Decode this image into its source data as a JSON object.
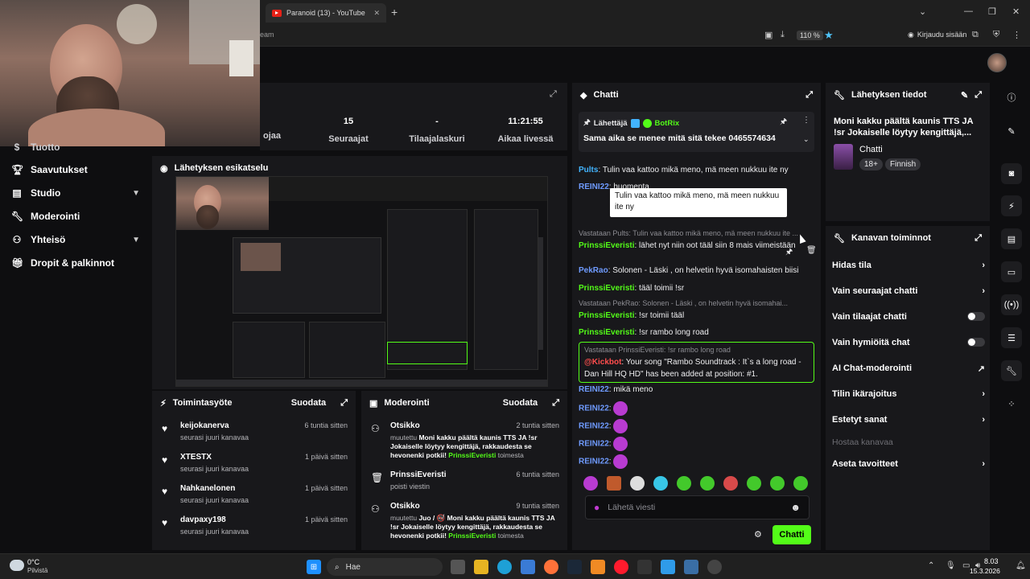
{
  "browser": {
    "tab_title": "Paranoid (13) - YouTube",
    "url_fragment": "eam",
    "zoom": "110 %",
    "login_label": "Kirjaudu sisään"
  },
  "stats": [
    {
      "value": "",
      "label": "ojaa"
    },
    {
      "value": "15",
      "label": "Seuraajat"
    },
    {
      "value": "-",
      "label": "Tilaajalaskuri"
    },
    {
      "value": "11:21:55",
      "label": "Aikaa livessä"
    }
  ],
  "nav": {
    "partial_top": "Tuotto",
    "items": [
      {
        "label": "Saavutukset",
        "icon": "trophy-icon",
        "chevron": false
      },
      {
        "label": "Studio",
        "icon": "film-icon",
        "chevron": true
      },
      {
        "label": "Moderointi",
        "icon": "wrench-icon",
        "chevron": false
      },
      {
        "label": "Yhteisö",
        "icon": "community-icon",
        "chevron": true
      },
      {
        "label": "Dropit & palkinnot",
        "icon": "gift-icon",
        "chevron": false
      }
    ]
  },
  "preview": {
    "title": "Lähetyksen esikatselu"
  },
  "activity": {
    "title": "Toimintasyöte",
    "filter": "Suodata",
    "items": [
      {
        "name": "keijokanerva",
        "sub": "seurasi juuri kanavaa",
        "time": "6 tuntia sitten"
      },
      {
        "name": "XTESTX",
        "sub": "seurasi juuri kanavaa",
        "time": "1 päivä sitten"
      },
      {
        "name": "Nahkanelonen",
        "sub": "seurasi juuri kanavaa",
        "time": "1 päivä sitten"
      },
      {
        "name": "davpaxy198",
        "sub": "seurasi juuri kanavaa",
        "time": "1 päivä sitten"
      }
    ]
  },
  "moderation": {
    "title": "Moderointi",
    "filter": "Suodata",
    "items": [
      {
        "name": "Otsikko",
        "time": "2 tuntia sitten",
        "line1": "muutettu ",
        "bold1": "Moni kakku päältä kaunis TTS JA !sr Jokaiselle löytyy kengittäjä, rakkaudesta se hevonenki potkii!",
        "by": "PrinssiEveristi",
        "tail": " toimesta"
      },
      {
        "name": "PrinssiEveristi",
        "time": "6 tuntia sitten",
        "line1": "poisti viestin"
      },
      {
        "name": "Otsikko",
        "time": "9 tuntia sitten",
        "line1": "muutettu ",
        "bold1": "Juo / 🚭 Moni kakku päältä kaunis TTS JA !sr Jokaiselle löytyy kengittäjä, rakkaudesta se hevonenki potkii!",
        "by": "PrinssiEveristi",
        "tail": " toimesta"
      }
    ]
  },
  "chat": {
    "title": "Chatti",
    "pinned": {
      "sender_label": "Lähettäjä",
      "sender": "BotRix",
      "text": "Sama aika se menee mitä sitä tekee 0465574634"
    },
    "tooltip": "Tulin vaa kattoo mikä meno, mä meen nukkuu ite ny",
    "messages": [
      {
        "user": "Pults",
        "text": " Tulin vaa kattoo mikä meno, mä meen nukkuu ite ny",
        "color": "#42b4ff"
      },
      {
        "user": "REINI22",
        "text": " huomenta",
        "color": "#6f9bff"
      },
      {
        "reply": "Vastataan Pults: Tulin vaa kattoo mikä meno, mä meen nukkuu ite ...",
        "user": "PrinssiEveristi",
        "text": " lähet nyt niin oot tääl siin 8 mais viimeistään",
        "color": "#53fc18"
      },
      {
        "user": "PekRao",
        "text": " Solonen - Läski , on helvetin hyvä isomahaisten biisi",
        "color": "#6f9bff"
      },
      {
        "user": "PrinssiEveristi",
        "text": " tääl toimii !sr",
        "color": "#53fc18"
      },
      {
        "reply": "Vastataan PekRao: Solonen - Läski , on helvetin hyvä isomahai...",
        "user": "PrinssiEveristi",
        "text": " !sr toimii tääl",
        "color": "#53fc18"
      },
      {
        "user": "PrinssiEveristi",
        "text": " !sr rambo long road",
        "color": "#53fc18"
      },
      {
        "reply": "Vastataan PrinssiEveristi: !sr rambo long road",
        "user": "@Kickbot",
        "text": " Your song \"Rambo Soundtrack : It`s a long road - Dan Hill HQ HD\" has been added at position: #1.",
        "color": "#ff4d4d"
      },
      {
        "user": "REINI22",
        "text": " mikä meno",
        "color": "#6f9bff"
      },
      {
        "user": "REINI22",
        "text": "",
        "color": "#6f9bff"
      },
      {
        "user": "REINI22",
        "text": "",
        "color": "#6f9bff"
      },
      {
        "user": "REINI22",
        "text": "",
        "color": "#6f9bff"
      },
      {
        "user": "REINI22",
        "text": "",
        "color": "#6f9bff"
      }
    ],
    "input_placeholder": "Lähetä viesti",
    "send_label": "Chatti"
  },
  "stream_info": {
    "title": "Lähetyksen tiedot",
    "text": "Moni kakku päältä kaunis TTS JA !sr Jokaiselle löytyy kengittäjä,...",
    "category": "Chatti",
    "tags": [
      "18+",
      "Finnish"
    ]
  },
  "channel_actions": {
    "title": "Kanavan toiminnot",
    "items": [
      {
        "label": "Hidas tila",
        "kind": "chevron"
      },
      {
        "label": "Vain seuraajat chatti",
        "kind": "chevron"
      },
      {
        "label": "Vain tilaajat chatti",
        "kind": "toggle"
      },
      {
        "label": "Vain hymiöitä chat",
        "kind": "toggle"
      },
      {
        "label": "AI Chat-moderointi",
        "kind": "external"
      },
      {
        "label": "Tilin ikärajoitus",
        "kind": "chevron"
      },
      {
        "label": "Estetyt sanat",
        "kind": "chevron"
      },
      {
        "label": "Hostaa kanavaa",
        "kind": "disabled"
      },
      {
        "label": "Aseta tavoitteet",
        "kind": "chevron"
      }
    ]
  },
  "taskbar": {
    "weather_temp": "0°C",
    "weather_desc": "Pilvistä",
    "search_label": "Hae",
    "time": "8.03",
    "date": "15.3.2026"
  },
  "colors": {
    "accent": "#53fc18",
    "panel": "#18181b",
    "bg": "#0e0e10"
  }
}
